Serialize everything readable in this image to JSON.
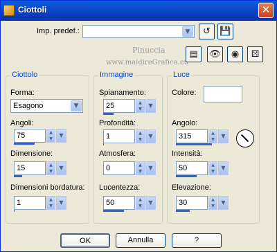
{
  "window": {
    "title": "Ciottoli"
  },
  "preset": {
    "label": "Imp. predef.:",
    "value": ""
  },
  "watermark": {
    "line1": "Pinuccia",
    "line2": "www.maidireGrafica.eu"
  },
  "groups": {
    "ciottolo": {
      "title": "Ciottolo",
      "forma_label": "Forma:",
      "forma_value": "Esagono",
      "angoli": {
        "label": "Angoli:",
        "value": "75",
        "fill": 0.5
      },
      "dimensione": {
        "label": "Dimensione:",
        "value": "15",
        "fill": 0.2
      },
      "bordatura": {
        "label": "Dimensioni bordatura:",
        "value": "1",
        "fill": 0.02
      }
    },
    "immagine": {
      "title": "Immagine",
      "spianamento": {
        "label": "Spianamento:",
        "value": "25",
        "fill": 0.25
      },
      "profondita": {
        "label": "Profondità:",
        "value": "1",
        "fill": 0.02
      },
      "atmosfera": {
        "label": "Atmosfera:",
        "value": "0",
        "fill": 0.0
      },
      "lucentezza": {
        "label": "Lucentezza:",
        "value": "50",
        "fill": 0.5
      }
    },
    "luce": {
      "title": "Luce",
      "colore_label": "Colore:",
      "colore_value": "#ffffff",
      "angolo": {
        "label": "Angolo:",
        "value": "315",
        "fill": 0.87
      },
      "intensita": {
        "label": "Intensità:",
        "value": "50",
        "fill": 0.5
      },
      "elevazione": {
        "label": "Elevazione:",
        "value": "30",
        "fill": 0.33
      }
    }
  },
  "buttons": {
    "ok": "OK",
    "cancel": "Annulla",
    "help": "?"
  }
}
